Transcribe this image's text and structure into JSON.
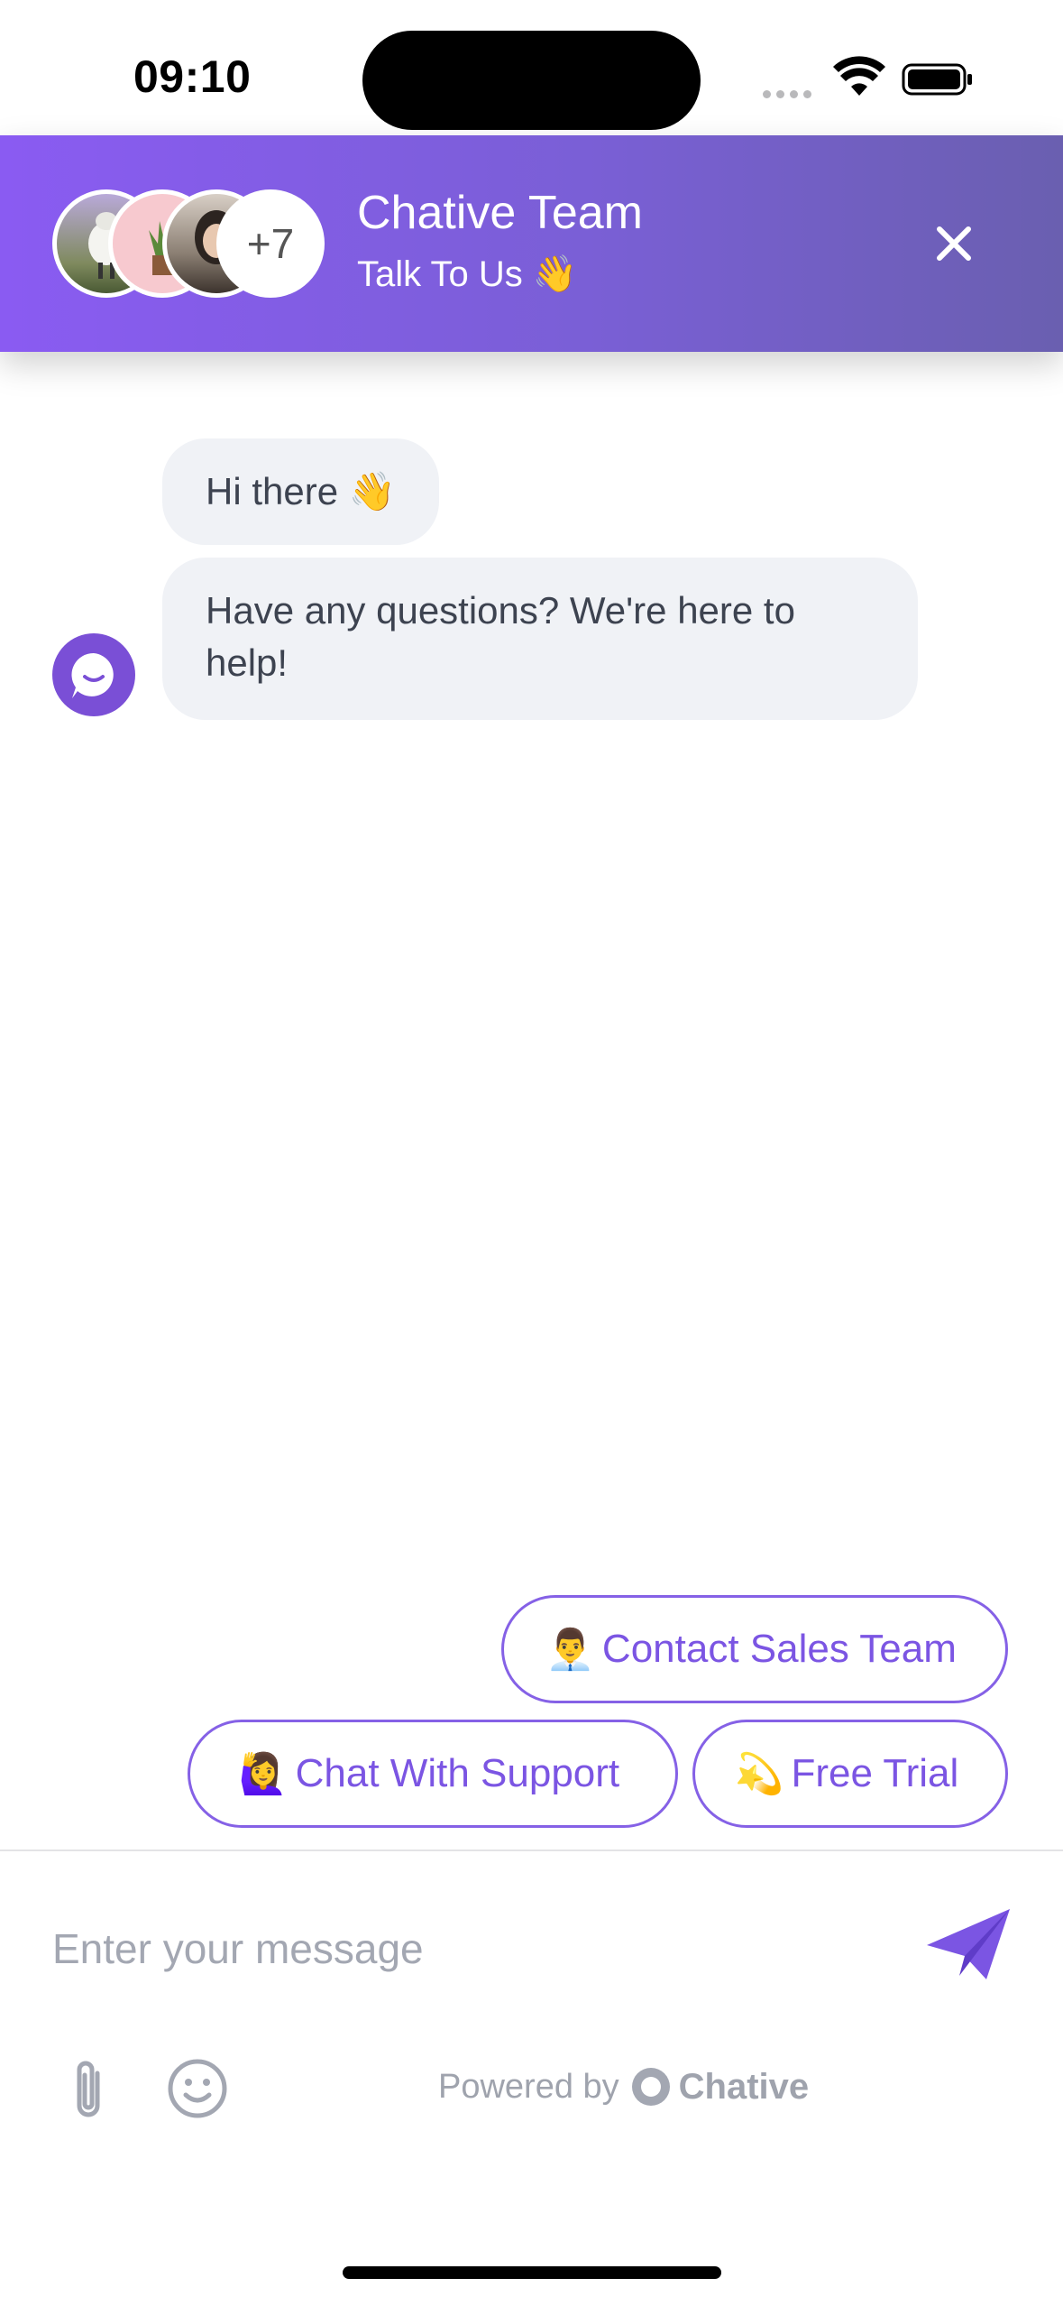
{
  "status_bar": {
    "time": "09:10"
  },
  "header": {
    "title": "Chative Team",
    "subtitle": "Talk To Us 👋",
    "more_count": "+7",
    "brand_color": "#8a5bf2"
  },
  "messages": [
    {
      "text": "Hi there 👋"
    },
    {
      "text": "Have any questions? We're here to help!"
    }
  ],
  "quick_replies": [
    {
      "emoji": "👨‍💼",
      "label": "Contact Sales Team"
    },
    {
      "emoji": "🙋‍♀️",
      "label": "Chat With Support"
    },
    {
      "emoji": "💫",
      "label": "Free Trial"
    }
  ],
  "composer": {
    "placeholder": "Enter your message"
  },
  "footer": {
    "powered_by": "Powered by",
    "brand": "Chative"
  },
  "icons": [
    "wifi-icon",
    "battery-icon",
    "close-icon",
    "send-icon",
    "paperclip-icon",
    "emoji-icon",
    "chative-logo-icon"
  ]
}
